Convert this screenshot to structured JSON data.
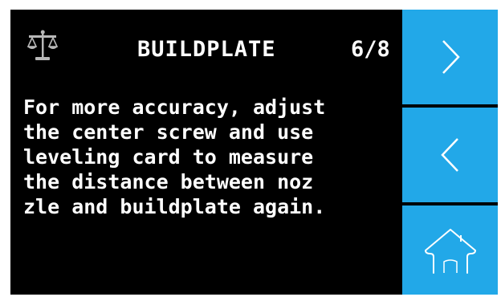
{
  "header": {
    "title": "BUILDPLATE",
    "page_indicator": "6/8",
    "icon": "scale-icon"
  },
  "instructions": {
    "lines": [
      "For more accuracy, adjust",
      "the center screw and use",
      "leveling card to measure",
      "the distance between noz",
      "zle and buildplate again."
    ]
  },
  "sidebar": {
    "next_icon": "chevron-right-icon",
    "prev_icon": "chevron-left-icon",
    "home_icon": "home-icon"
  },
  "colors": {
    "background": "#000000",
    "accent": "#22a8e8",
    "text": "#ffffff"
  }
}
